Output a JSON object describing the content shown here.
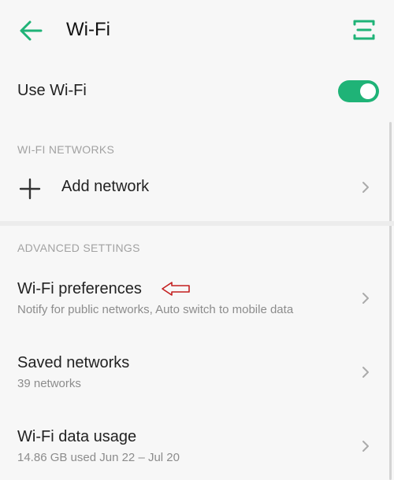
{
  "header": {
    "title": "Wi-Fi",
    "back_icon": "back-arrow-icon",
    "menu_icon": "menu-icon",
    "accent": "#1fb377"
  },
  "use_wifi": {
    "label": "Use Wi-Fi",
    "toggle_on": true
  },
  "networks_section": {
    "header": "WI-FI NETWORKS",
    "add_network": "Add network"
  },
  "advanced_section": {
    "header": "ADVANCED SETTINGS",
    "items": [
      {
        "title": "Wi-Fi preferences",
        "subtitle": "Notify for public networks, Auto switch to mobile data"
      },
      {
        "title": "Saved networks",
        "subtitle": "39 networks"
      },
      {
        "title": "Wi-Fi data usage",
        "subtitle": "14.86 GB used Jun 22 – Jul 20"
      }
    ]
  },
  "annotation": {
    "color": "#c41f1f"
  }
}
